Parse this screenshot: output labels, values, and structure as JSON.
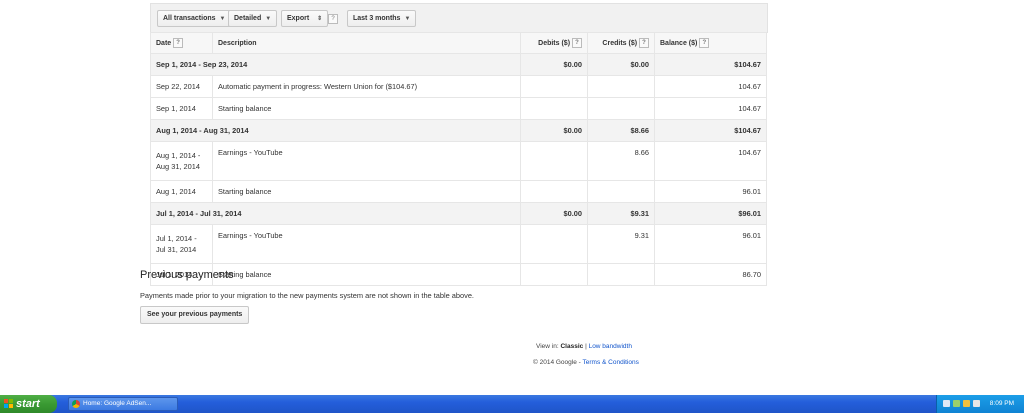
{
  "toolbar": {
    "filter_label": "All transactions",
    "view_label": "Detailed",
    "export_label": "Export",
    "export_help": "?",
    "range_label": "Last 3 months"
  },
  "table": {
    "headers": {
      "date": "Date",
      "description": "Description",
      "debits": "Debits ($)",
      "credits": "Credits ($)",
      "balance": "Balance ($)",
      "help": "?"
    },
    "rows": [
      {
        "type": "period",
        "date": "Sep 1, 2014 - Sep 23, 2014",
        "description": "",
        "debits": "$0.00",
        "credits": "$0.00",
        "balance": "$104.67"
      },
      {
        "type": "std",
        "date": "Sep 22, 2014",
        "description": "Automatic payment in progress: Western Union for ($104.67)",
        "debits": "",
        "credits": "",
        "balance": "104.67"
      },
      {
        "type": "std",
        "date": "Sep 1, 2014",
        "description": "Starting balance",
        "debits": "",
        "credits": "",
        "balance": "104.67"
      },
      {
        "type": "period",
        "date": "Aug 1, 2014 - Aug 31, 2014",
        "description": "",
        "debits": "$0.00",
        "credits": "$8.66",
        "balance": "$104.67"
      },
      {
        "type": "tall",
        "date_line1": "Aug 1, 2014 -",
        "date_line2": "Aug 31, 2014",
        "description": "Earnings - YouTube",
        "debits": "",
        "credits": "8.66",
        "balance": "104.67"
      },
      {
        "type": "std",
        "date": "Aug 1, 2014",
        "description": "Starting balance",
        "debits": "",
        "credits": "",
        "balance": "96.01"
      },
      {
        "type": "period",
        "date": "Jul 1, 2014 - Jul 31, 2014",
        "description": "",
        "debits": "$0.00",
        "credits": "$9.31",
        "balance": "$96.01"
      },
      {
        "type": "tall",
        "date_line1": "Jul 1, 2014 -",
        "date_line2": "Jul 31, 2014",
        "description": "Earnings - YouTube",
        "debits": "",
        "credits": "9.31",
        "balance": "96.01"
      },
      {
        "type": "std",
        "date": "Jul 1, 2014",
        "description": "Starting balance",
        "debits": "",
        "credits": "",
        "balance": "86.70"
      }
    ]
  },
  "previous_payments": {
    "title": "Previous payments",
    "text": "Payments made prior to your migration to the new payments system are not shown in the table above.",
    "button_label": "See your previous payments"
  },
  "footer": {
    "view_in": "View in:",
    "classic": "Classic",
    "separator": "|",
    "low_bandwidth": "Low bandwidth",
    "copyright": "© 2014 Google -",
    "terms": "Terms & Conditions"
  },
  "taskbar": {
    "start_label": "start",
    "task_label": "Home: Google AdSen...",
    "clock": "8:09 PM"
  },
  "colors": {
    "link": "#1155cc",
    "taskbar": "#245edb",
    "start_button": "#3a9a33",
    "tray": "#0f83d3"
  }
}
